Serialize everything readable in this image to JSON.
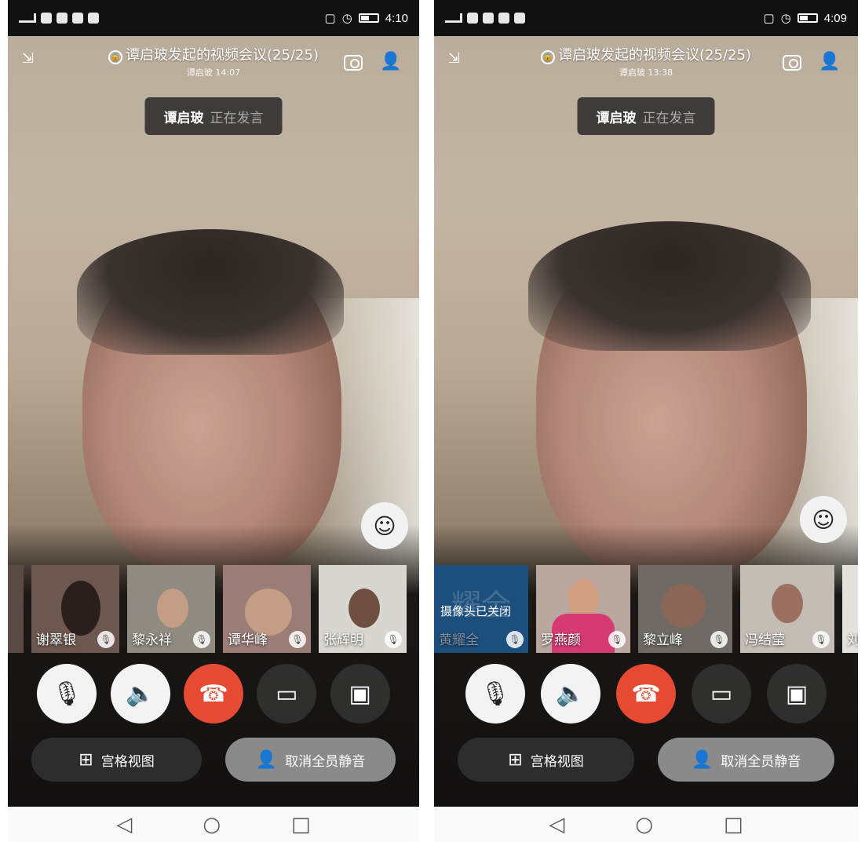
{
  "screens": [
    {
      "status": {
        "time": "4:10",
        "signal": "56"
      },
      "meeting": {
        "title": "谭启玻发起的视频会议(25/25)",
        "subtitle": "谭启玻 14:07"
      },
      "speaker": {
        "name": "谭启玻",
        "status": "正在发言"
      },
      "thumbnails": [
        {
          "name": "谢翠银"
        },
        {
          "name": "黎永祥"
        },
        {
          "name": "谭华峰"
        },
        {
          "name": "张辉明"
        }
      ],
      "buttons": {
        "grid_view": "宫格视图",
        "unmute_all": "取消全员静音"
      }
    },
    {
      "status": {
        "time": "4:09",
        "signal": "56"
      },
      "meeting": {
        "title": "谭启玻发起的视频会议(25/25)",
        "subtitle": "谭启玻 13:38"
      },
      "speaker": {
        "name": "谭启玻",
        "status": "正在发言"
      },
      "thumbnails": [
        {
          "name": "黄耀全",
          "camera_off": "摄像头已关闭",
          "bg_text": "耀全"
        },
        {
          "name": "罗燕颜"
        },
        {
          "name": "黎立峰"
        },
        {
          "name": "冯结莹"
        },
        {
          "name": "刘"
        }
      ],
      "buttons": {
        "grid_view": "宫格视图",
        "unmute_all": "取消全员静音"
      }
    }
  ]
}
